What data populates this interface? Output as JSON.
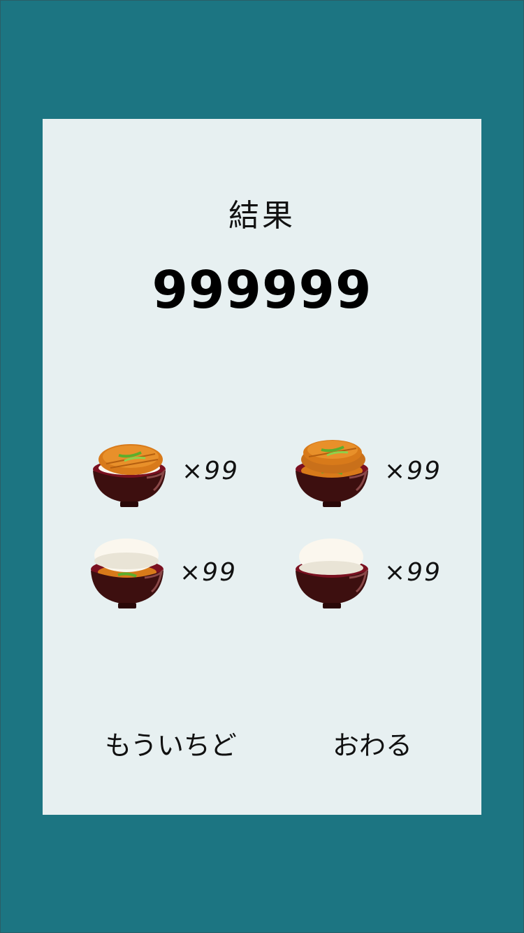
{
  "result": {
    "title": "結果",
    "score": "999999"
  },
  "items": [
    {
      "icon": "katsudon-bowl-icon",
      "count": "×99"
    },
    {
      "icon": "double-katsudon-bowl-icon",
      "count": "×99"
    },
    {
      "icon": "rice-over-katsu-bowl-icon",
      "count": "×99"
    },
    {
      "icon": "plain-rice-bowl-icon",
      "count": "×99"
    }
  ],
  "buttons": {
    "retry": "もういちど",
    "quit": "おわる"
  },
  "colors": {
    "background": "#1c7582",
    "panel": "#e7f0f1",
    "bowl": "#3d0f0f",
    "bowl_inner": "#7a1020",
    "katsu": "#d87a1a",
    "rice": "#fbf7ee",
    "green_onion": "#5cae2c"
  }
}
